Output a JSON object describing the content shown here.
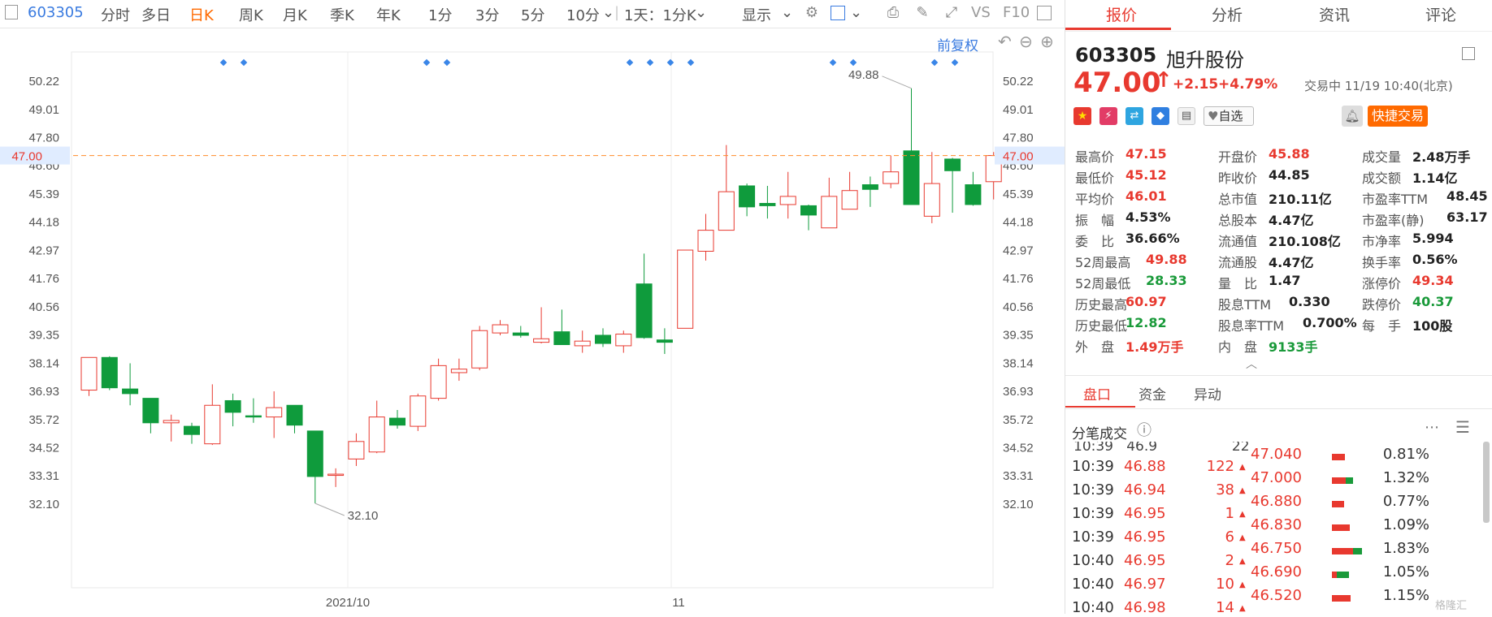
{
  "toolbar": {
    "code": "603305",
    "periods": [
      "分时",
      "多日",
      "日K",
      "周K",
      "月K",
      "季K",
      "年K",
      "1分",
      "3分",
      "5分",
      "10分"
    ],
    "active_period": "日K",
    "multi_day": "1天：1分K",
    "display": "显示",
    "vs": "VS",
    "f10": "F10"
  },
  "chart_controls": {
    "adjust": "前复权"
  },
  "right_tabs": [
    "报价",
    "分析",
    "资讯",
    "评论"
  ],
  "stock": {
    "code": "603305",
    "name": "旭升股份",
    "price": "47.00",
    "change": "+2.15",
    "change_pct": "+4.79%",
    "status_time": "交易中 11/19 10:40(北京)",
    "watch_label": "自选",
    "trade_button": "快捷交易"
  },
  "quote_grid": [
    [
      {
        "label": "最高价",
        "value": "47.15",
        "color": "red"
      },
      {
        "label": "开盘价",
        "value": "45.88",
        "color": "red"
      },
      {
        "label": "成交量",
        "value": "2.48万手",
        "color": "black"
      }
    ],
    [
      {
        "label": "最低价",
        "value": "45.12",
        "color": "red"
      },
      {
        "label": "昨收价",
        "value": "44.85",
        "color": "black"
      },
      {
        "label": "成交额",
        "value": "1.14亿",
        "color": "black"
      }
    ],
    [
      {
        "label": "平均价",
        "value": "46.01",
        "color": "red"
      },
      {
        "label": "总市值",
        "value": "210.11亿",
        "color": "black"
      },
      {
        "label": "市盈率TTM",
        "value": "48.45",
        "color": "black"
      }
    ],
    [
      {
        "label": "振　幅",
        "value": "4.53%",
        "color": "black"
      },
      {
        "label": "总股本",
        "value": "4.47亿",
        "color": "black"
      },
      {
        "label": "市盈率(静)",
        "value": "63.17",
        "color": "black"
      }
    ],
    [
      {
        "label": "委　比",
        "value": "36.66%",
        "color": "black"
      },
      {
        "label": "流通值",
        "value": "210.108亿",
        "color": "black"
      },
      {
        "label": "市净率",
        "value": "5.994",
        "color": "black"
      }
    ],
    [
      {
        "label": "52周最高",
        "value": "49.88",
        "color": "red"
      },
      {
        "label": "流通股",
        "value": "4.47亿",
        "color": "black"
      },
      {
        "label": "换手率",
        "value": "0.56%",
        "color": "black"
      }
    ],
    [
      {
        "label": "52周最低",
        "value": "28.33",
        "color": "green"
      },
      {
        "label": "量　比",
        "value": "1.47",
        "color": "black"
      },
      {
        "label": "涨停价",
        "value": "49.34",
        "color": "red"
      }
    ],
    [
      {
        "label": "历史最高",
        "value": "60.97",
        "color": "red"
      },
      {
        "label": "股息TTM",
        "value": "0.330",
        "color": "black"
      },
      {
        "label": "跌停价",
        "value": "40.37",
        "color": "green"
      }
    ],
    [
      {
        "label": "历史最低",
        "value": "12.82",
        "color": "green"
      },
      {
        "label": "股息率TTM",
        "value": "0.700%",
        "color": "black"
      },
      {
        "label": "每　手",
        "value": "100股",
        "color": "black"
      }
    ],
    [
      {
        "label": "外　盘",
        "value": "1.49万手",
        "color": "red"
      },
      {
        "label": "内　盘",
        "value": "9133手",
        "color": "green"
      }
    ]
  ],
  "sub_tabs": [
    "盘口",
    "资金",
    "异动"
  ],
  "ticks_title": "分笔成交",
  "ticks": [
    {
      "time": "10:39",
      "price": "46.88",
      "vol": "122"
    },
    {
      "time": "10:39",
      "price": "46.94",
      "vol": "38"
    },
    {
      "time": "10:39",
      "price": "46.95",
      "vol": "1"
    },
    {
      "time": "10:39",
      "price": "46.95",
      "vol": "6"
    },
    {
      "time": "10:40",
      "price": "46.95",
      "vol": "2"
    },
    {
      "time": "10:40",
      "price": "46.97",
      "vol": "10"
    },
    {
      "time": "10:40",
      "price": "46.98",
      "vol": "14"
    }
  ],
  "depth": [
    {
      "price": "47.040",
      "pct": "0.81%",
      "share": 0.81,
      "buy": 0
    },
    {
      "price": "47.000",
      "pct": "1.32%",
      "share": 1.32,
      "buy": 0.35
    },
    {
      "price": "46.880",
      "pct": "0.77%",
      "share": 0.77,
      "buy": 0
    },
    {
      "price": "46.830",
      "pct": "1.09%",
      "share": 1.09,
      "buy": 0
    },
    {
      "price": "46.750",
      "pct": "1.83%",
      "share": 1.83,
      "buy": 0.3
    },
    {
      "price": "46.690",
      "pct": "1.05%",
      "share": 1.05,
      "buy": 0.7
    },
    {
      "price": "46.520",
      "pct": "1.15%",
      "share": 1.15,
      "buy": 0
    }
  ],
  "watermark": "格隆汇",
  "chart_data": {
    "type": "candlestick",
    "y_ticks": [
      "50.22",
      "49.01",
      "47.80",
      "47.00",
      "46.60",
      "45.39",
      "44.18",
      "42.97",
      "41.76",
      "40.56",
      "39.35",
      "38.14",
      "36.93",
      "35.72",
      "34.52",
      "33.31",
      "32.10"
    ],
    "ylim": [
      31.5,
      51.0
    ],
    "current_price": 47.0,
    "x_labels": [
      "2021/10",
      "11"
    ],
    "annotations": {
      "high": "49.88",
      "low": "32.10"
    },
    "candles": [
      {
        "o": 36.95,
        "c": 38.35,
        "h": 38.35,
        "l": 36.7
      },
      {
        "o": 38.35,
        "c": 37.05,
        "h": 38.4,
        "l": 36.95
      },
      {
        "o": 37.0,
        "c": 36.8,
        "h": 38.1,
        "l": 36.3
      },
      {
        "o": 36.6,
        "c": 35.55,
        "h": 36.6,
        "l": 35.1
      },
      {
        "o": 35.55,
        "c": 35.65,
        "h": 35.9,
        "l": 34.75
      },
      {
        "o": 35.4,
        "c": 35.05,
        "h": 35.55,
        "l": 34.65
      },
      {
        "o": 34.65,
        "c": 36.3,
        "h": 37.2,
        "l": 34.6
      },
      {
        "o": 36.5,
        "c": 36.0,
        "h": 36.8,
        "l": 35.4
      },
      {
        "o": 35.85,
        "c": 35.8,
        "h": 36.6,
        "l": 35.55
      },
      {
        "o": 35.8,
        "c": 36.2,
        "h": 36.9,
        "l": 34.9
      },
      {
        "o": 36.3,
        "c": 35.45,
        "h": 36.3,
        "l": 35.1
      },
      {
        "o": 35.2,
        "c": 33.25,
        "h": 35.2,
        "l": 32.1
      },
      {
        "o": 33.3,
        "c": 33.35,
        "h": 33.6,
        "l": 32.8
      },
      {
        "o": 34.0,
        "c": 34.75,
        "h": 35.1,
        "l": 33.7
      },
      {
        "o": 34.3,
        "c": 35.8,
        "h": 36.5,
        "l": 34.25
      },
      {
        "o": 35.75,
        "c": 35.45,
        "h": 36.1,
        "l": 35.3
      },
      {
        "o": 35.4,
        "c": 36.7,
        "h": 36.8,
        "l": 35.2
      },
      {
        "o": 36.6,
        "c": 38.0,
        "h": 38.3,
        "l": 36.5
      },
      {
        "o": 37.7,
        "c": 37.85,
        "h": 38.3,
        "l": 37.35
      },
      {
        "o": 37.9,
        "c": 39.5,
        "h": 39.7,
        "l": 37.8
      },
      {
        "o": 39.4,
        "c": 39.75,
        "h": 39.95,
        "l": 39.3
      },
      {
        "o": 39.4,
        "c": 39.3,
        "h": 39.7,
        "l": 39.2
      },
      {
        "o": 39.0,
        "c": 39.15,
        "h": 40.5,
        "l": 38.95
      },
      {
        "o": 39.45,
        "c": 38.9,
        "h": 40.4,
        "l": 38.9
      },
      {
        "o": 38.85,
        "c": 39.05,
        "h": 39.5,
        "l": 38.55
      },
      {
        "o": 39.3,
        "c": 38.95,
        "h": 39.6,
        "l": 38.8
      },
      {
        "o": 38.85,
        "c": 39.35,
        "h": 39.5,
        "l": 38.55
      },
      {
        "o": 41.5,
        "c": 39.2,
        "h": 42.8,
        "l": 39.15
      },
      {
        "o": 39.1,
        "c": 39.0,
        "h": 39.6,
        "l": 38.5
      },
      {
        "o": 39.6,
        "c": 42.95,
        "h": 42.95,
        "l": 39.6
      },
      {
        "o": 42.9,
        "c": 43.8,
        "h": 44.5,
        "l": 42.5
      },
      {
        "o": 43.8,
        "c": 45.45,
        "h": 47.45,
        "l": 43.8
      },
      {
        "o": 45.7,
        "c": 44.8,
        "h": 45.8,
        "l": 44.4
      },
      {
        "o": 44.95,
        "c": 44.85,
        "h": 45.7,
        "l": 44.3
      },
      {
        "o": 44.9,
        "c": 45.25,
        "h": 46.3,
        "l": 44.3
      },
      {
        "o": 44.85,
        "c": 44.45,
        "h": 44.9,
        "l": 43.8
      },
      {
        "o": 43.9,
        "c": 45.25,
        "h": 46.05,
        "l": 43.9
      },
      {
        "o": 44.7,
        "c": 45.5,
        "h": 46.3,
        "l": 44.7
      },
      {
        "o": 45.75,
        "c": 45.55,
        "h": 46.1,
        "l": 44.8
      },
      {
        "o": 45.8,
        "c": 46.3,
        "h": 47.0,
        "l": 45.6
      },
      {
        "o": 47.2,
        "c": 44.9,
        "h": 49.88,
        "l": 44.9
      },
      {
        "o": 44.4,
        "c": 45.8,
        "h": 47.15,
        "l": 44.1
      },
      {
        "o": 46.85,
        "c": 46.35,
        "h": 46.9,
        "l": 44.55
      },
      {
        "o": 45.75,
        "c": 44.9,
        "h": 46.3,
        "l": 44.85
      },
      {
        "o": 45.88,
        "c": 47.0,
        "h": 47.15,
        "l": 45.12
      }
    ]
  }
}
